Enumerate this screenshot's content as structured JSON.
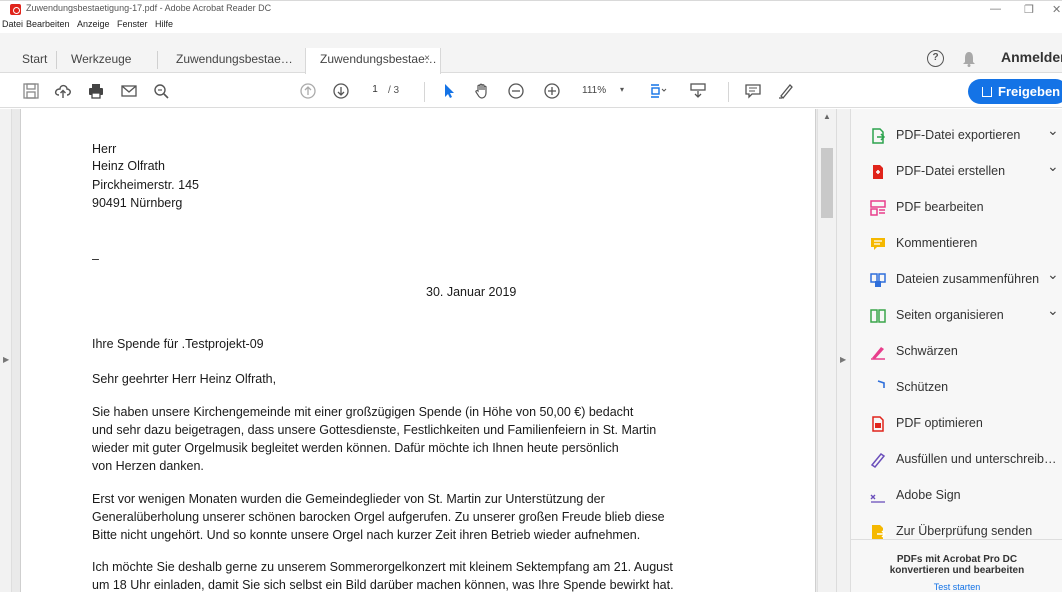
{
  "window": {
    "title": "Zuwendungsbestaetigung-17.pdf - Adobe Acrobat Reader DC",
    "minimize": "—",
    "restore": "❐",
    "close": "✕"
  },
  "menu": [
    "Datei",
    "Bearbeiten",
    "Anzeige",
    "Fenster",
    "Hilfe"
  ],
  "tabs": {
    "start": "Start",
    "tools": "Werkzeuge",
    "doc1": "Zuwendungsbestae…",
    "doc2": "Zuwendungsbestae…",
    "close_glyph": "×",
    "help": "?",
    "signin": "Anmelden"
  },
  "toolbar": {
    "page_current": "1",
    "page_total": "/ 3",
    "zoom": "111%",
    "zoom_arrow": "▾",
    "share": "Freigeben"
  },
  "letter": {
    "address": [
      "Herr",
      "Heinz Olfrath",
      "Pirckheimerstr. 145",
      "90491 Nürnberg"
    ],
    "dash": "–",
    "date": "30. Januar 2019",
    "subject": "Ihre Spende für .Testprojekt-09",
    "salutation": "Sehr geehrter Herr Heinz Olfrath,",
    "para1": [
      "Sie haben unsere Kirchengemeinde mit einer großzügigen Spende (in Höhe von 50,00 €) bedacht",
      "und sehr dazu beigetragen, dass unsere Gottesdienste, Festlichkeiten und Familienfeiern in St. Martin",
      "wieder mit guter Orgelmusik begleitet werden können. Dafür möchte ich Ihnen heute persönlich",
      "von Herzen danken."
    ],
    "para2": [
      "Erst vor wenigen Monaten wurden die Gemeindeglieder von St. Martin zur Unterstützung der",
      "Generalüberholung unserer schönen barocken Orgel aufgerufen. Zu unserer großen Freude blieb diese",
      "Bitte nicht ungehört. Und so konnte unsere Orgel nach kurzer Zeit ihren Betrieb wieder aufnehmen."
    ],
    "para3": [
      "Ich möchte Sie deshalb gerne zu unserem Sommerorgelkonzert mit kleinem Sektempfang am 21. August",
      "um 18 Uhr einladen, damit Sie sich selbst ein Bild darüber machen können, was Ihre Spende bewirkt hat."
    ]
  },
  "tools": [
    {
      "label": "PDF-Datei exportieren",
      "icon": "export-pdf-icon",
      "color": "#2da44e",
      "chevron": true
    },
    {
      "label": "PDF-Datei erstellen",
      "icon": "create-pdf-icon",
      "color": "#e0241b",
      "chevron": true
    },
    {
      "label": "PDF bearbeiten",
      "icon": "edit-pdf-icon",
      "color": "#e83e8c",
      "chevron": false
    },
    {
      "label": "Kommentieren",
      "icon": "comment-icon",
      "color": "#f5b800",
      "chevron": false
    },
    {
      "label": "Dateien zusammenführen",
      "icon": "combine-files-icon",
      "color": "#2f6fdb",
      "chevron": true
    },
    {
      "label": "Seiten organisieren",
      "icon": "organize-pages-icon",
      "color": "#3aa64a",
      "chevron": true
    },
    {
      "label": "Schwärzen",
      "icon": "redact-icon",
      "color": "#e83e8c",
      "chevron": false
    },
    {
      "label": "Schützen",
      "icon": "protect-icon",
      "color": "#2f6fdb",
      "chevron": false
    },
    {
      "label": "PDF optimieren",
      "icon": "optimize-pdf-icon",
      "color": "#e0241b",
      "chevron": false
    },
    {
      "label": "Ausfüllen und unterschreib…",
      "icon": "fill-sign-icon",
      "color": "#6b4fbb",
      "chevron": false
    },
    {
      "label": "Adobe Sign",
      "icon": "adobe-sign-icon",
      "color": "#6b4fbb",
      "chevron": false
    },
    {
      "label": "Zur Überprüfung senden",
      "icon": "send-review-icon",
      "color": "#f5b800",
      "chevron": false
    }
  ],
  "promo": {
    "line1": "PDFs mit Acrobat Pro DC",
    "line2": "konvertieren und bearbeiten",
    "line3": "Test starten"
  }
}
